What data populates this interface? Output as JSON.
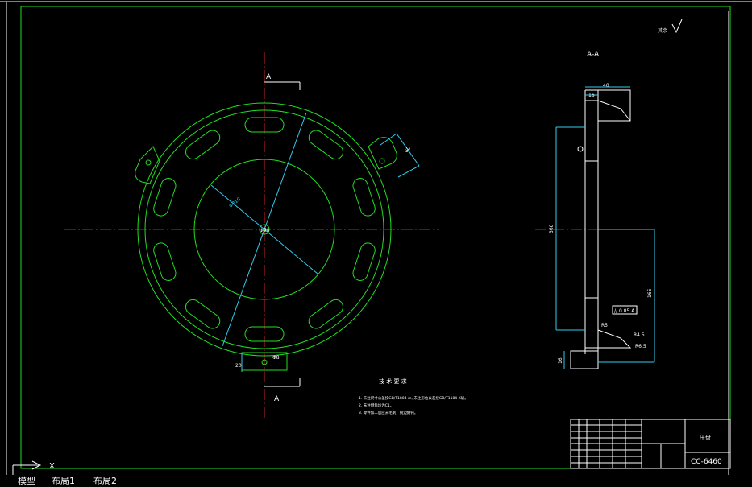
{
  "drawing": {
    "section_label": "A",
    "section_title": "A-A",
    "roughness_note": "其余",
    "tech_req_title": "技 术 要 求",
    "tech_req_lines": [
      "1. 未注尺寸公差按GB/T1804-m, 未注形位公差按GB/T1184-K级。",
      "2. 未注倒角均为C1。",
      "3. 零件加工后应去毛刺，锐边倒钝。"
    ],
    "dimensions": {
      "front_inner_dia": "Φ310",
      "front_center": "Φ90",
      "lug_width": "60",
      "bottom_lug": "Φ8",
      "bottom_lug_side": "20",
      "section_top_width": "40",
      "section_top_inner": "16",
      "section_height": "360",
      "section_half_height": "165",
      "section_thickness": "16",
      "section_hole": "Φ8",
      "section_fillet": "R4.5",
      "section_chamfer": "R6.5",
      "tolerance_frame": "// 0.05 A",
      "section_r": "R5"
    },
    "title_block": {
      "part_name": "压盘",
      "drawing_no": "CC-6460"
    }
  },
  "ucs": {
    "x_label": "X",
    "y_label": "Y"
  },
  "tabs": [
    "模型",
    "布局1",
    "布局2"
  ]
}
